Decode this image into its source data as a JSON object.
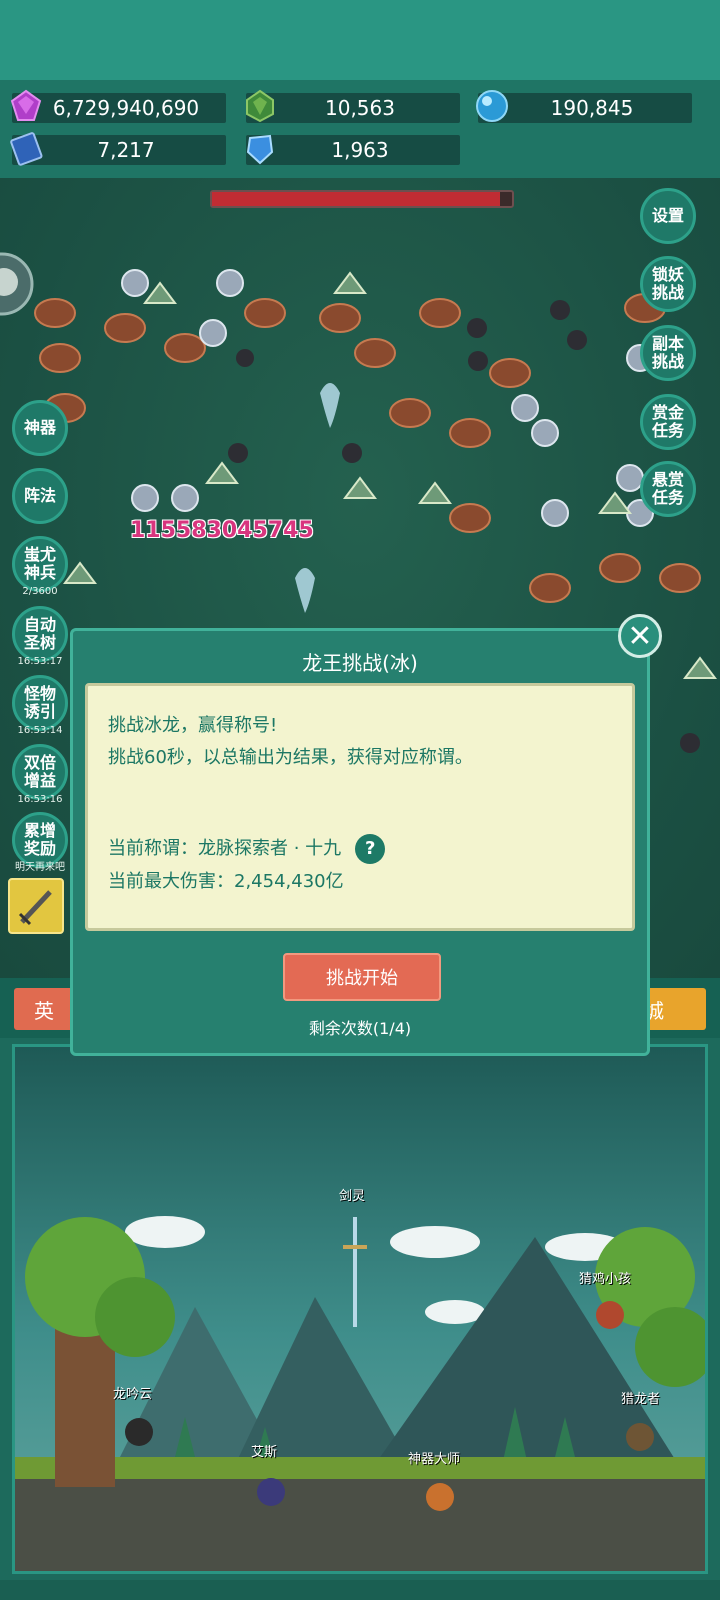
{
  "resources": [
    {
      "icon": "purple-gem-icon",
      "value": "6,729,940,690"
    },
    {
      "icon": "green-gem-icon",
      "value": "10,563"
    },
    {
      "icon": "blue-orb-icon",
      "value": "190,845"
    },
    {
      "icon": "blue-book-icon",
      "value": "7,217"
    },
    {
      "icon": "blue-crystal-icon",
      "value": "1,963"
    }
  ],
  "right_menu": [
    "设置",
    "锁妖\n挑战",
    "副本\n挑战",
    "赏金\n任务",
    "悬赏\n任务"
  ],
  "left_menu": [
    {
      "label": "神器",
      "timer": ""
    },
    {
      "label": "阵法",
      "timer": ""
    },
    {
      "label": "蚩尤\n神兵",
      "timer": "2/3600"
    },
    {
      "label": "自动\n圣树",
      "timer": "16:53:17"
    },
    {
      "label": "怪物\n诱引",
      "timer": "16:53:14"
    },
    {
      "label": "双倍\n增益",
      "timer": "16:53:16"
    },
    {
      "label": "累增\n奖励",
      "timer": "明天再来吧"
    }
  ],
  "damage_number": "115583045745",
  "modal": {
    "title": "龙王挑战(冰)",
    "desc_line1": "挑战冰龙，赢得称号!",
    "desc_line2": "挑战60秒，以总输出为结果，获得对应称谓。",
    "current_title_label": "当前称谓：龙脉探索者 · 十九",
    "max_damage_label": "当前最大伤害：2,454,430亿",
    "help": "?",
    "start_button": "挑战开始",
    "remaining": "剩余次数(1/4)"
  },
  "tabs": {
    "left": "英",
    "right": "城"
  },
  "characters": {
    "sword_spirit": "剑灵",
    "long_yin_yun": "龙吟云",
    "ai_si": "艾斯",
    "artifact_master": "神器大师",
    "chicken_kid": "猜鸡小孩",
    "dragon_hunter": "猎龙者"
  },
  "colors": {
    "accent": "#2a9683",
    "button": "#e36a54",
    "gold": "#e8a42c"
  }
}
